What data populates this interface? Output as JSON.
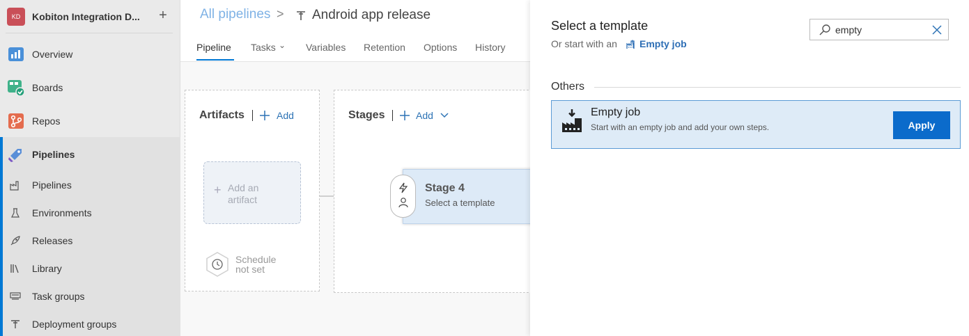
{
  "org": {
    "initials": "KD",
    "name": "Kobiton Integration D...",
    "add_glyph": "+"
  },
  "nav": {
    "overview": "Overview",
    "boards": "Boards",
    "repos": "Repos",
    "pipelines": "Pipelines"
  },
  "subnav": {
    "pipelines": "Pipelines",
    "environments": "Environments",
    "releases": "Releases",
    "library": "Library",
    "task_groups": "Task groups",
    "deployment_groups": "Deployment groups"
  },
  "breadcrumb": {
    "root": "All pipelines",
    "separator": ">",
    "title": "Android app release"
  },
  "tabs": {
    "pipeline": "Pipeline",
    "tasks": "Tasks",
    "tasks_chevron": "⌄",
    "variables": "Variables",
    "retention": "Retention",
    "options": "Options",
    "history": "History"
  },
  "artifacts": {
    "title": "Artifacts",
    "add": "Add",
    "placeholder": "Add an artifact",
    "schedule": "Schedule not set"
  },
  "stages": {
    "title": "Stages",
    "add": "Add",
    "stage_name": "Stage 4",
    "stage_sub": "Select a template"
  },
  "panel": {
    "title": "Select a template",
    "or_start": "Or start with an",
    "empty_job_link": "Empty job",
    "search_value": "empty",
    "section": "Others",
    "template": {
      "name": "Empty job",
      "description": "Start with an empty job and add your own steps.",
      "apply": "Apply"
    }
  },
  "colors": {
    "accent": "#0078d4",
    "apply": "#0b6bcb",
    "selected_card": "#deebf7",
    "org_badge": "#c94f58"
  }
}
